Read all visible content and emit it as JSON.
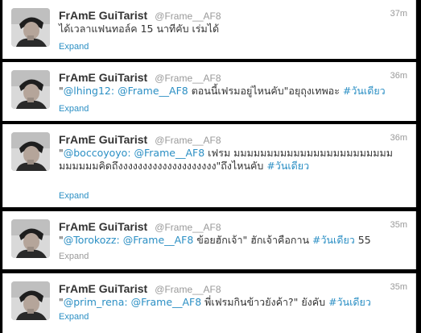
{
  "colors": {
    "link": "#2b8fc4",
    "text": "#333333",
    "meta": "#999999",
    "background": "#ffffff",
    "frame": "#000000"
  },
  "tweets": [
    {
      "fullname": "FrAmE GuiTarist",
      "username": "@Frame__AF8",
      "time": "37m",
      "text_segments": [
        {
          "text": "ได้เวลาแฟนทอล์ค 15 นาทีคับ เร่มได้",
          "link": false
        }
      ],
      "expand": "Expand",
      "expand_color": "blue"
    },
    {
      "fullname": "FrAmE GuiTarist",
      "username": "@Frame__AF8",
      "time": "36m",
      "text_segments": [
        {
          "text": "\"",
          "link": false
        },
        {
          "text": "@lhing12",
          "link": true
        },
        {
          "text": ": ",
          "link": true
        },
        {
          "text": "@Frame__AF8",
          "link": true
        },
        {
          "text": " ตอนนี้เฟรมอยู่ไหนคับ\"อยุถุงเทพอะ ",
          "link": false
        },
        {
          "text": "#วันเดียว",
          "link": true
        }
      ],
      "expand": "Expand",
      "expand_color": "blue"
    },
    {
      "fullname": "FrAmE GuiTarist",
      "username": "@Frame__AF8",
      "time": "36m",
      "text_segments": [
        {
          "text": "\"",
          "link": false
        },
        {
          "text": "@boccoyoyo",
          "link": true
        },
        {
          "text": ": ",
          "link": true
        },
        {
          "text": "@Frame__AF8",
          "link": true
        },
        {
          "text": " เฟรม มมมมมมมมมมมมมมมมมมมมมมมมมมมมมมคิดถึงงงงงงงงงงงงงงงงงงงง\"ถึงไหนคับ ",
          "link": false
        },
        {
          "text": "#วันเดียว",
          "link": true
        }
      ],
      "expand": "Expand",
      "expand_color": "blue"
    },
    {
      "fullname": "FrAmE GuiTarist",
      "username": "@Frame__AF8",
      "time": "35m",
      "text_segments": [
        {
          "text": "\"",
          "link": false
        },
        {
          "text": "@Torokozz",
          "link": true
        },
        {
          "text": ": ",
          "link": true
        },
        {
          "text": "@Frame__AF8",
          "link": true
        },
        {
          "text": " ข้อยฮักเจ้า\" ฮักเจ้าคือกาน ",
          "link": false
        },
        {
          "text": "#วันเดียว",
          "link": true
        },
        {
          "text": " 55",
          "link": false
        }
      ],
      "expand": "Expand",
      "expand_color": "gray"
    },
    {
      "fullname": "FrAmE GuiTarist",
      "username": "@Frame__AF8",
      "time": "35m",
      "text_segments": [
        {
          "text": "\"",
          "link": false
        },
        {
          "text": "@prim_rena",
          "link": true
        },
        {
          "text": ": ",
          "link": true
        },
        {
          "text": "@Frame__AF8",
          "link": true
        },
        {
          "text": " พี่เฟรมกินข้าวยังค้า?\" ยังคับ ",
          "link": false
        },
        {
          "text": "#วันเดียว",
          "link": true
        }
      ],
      "expand": "Expand",
      "expand_color": "blue"
    }
  ]
}
